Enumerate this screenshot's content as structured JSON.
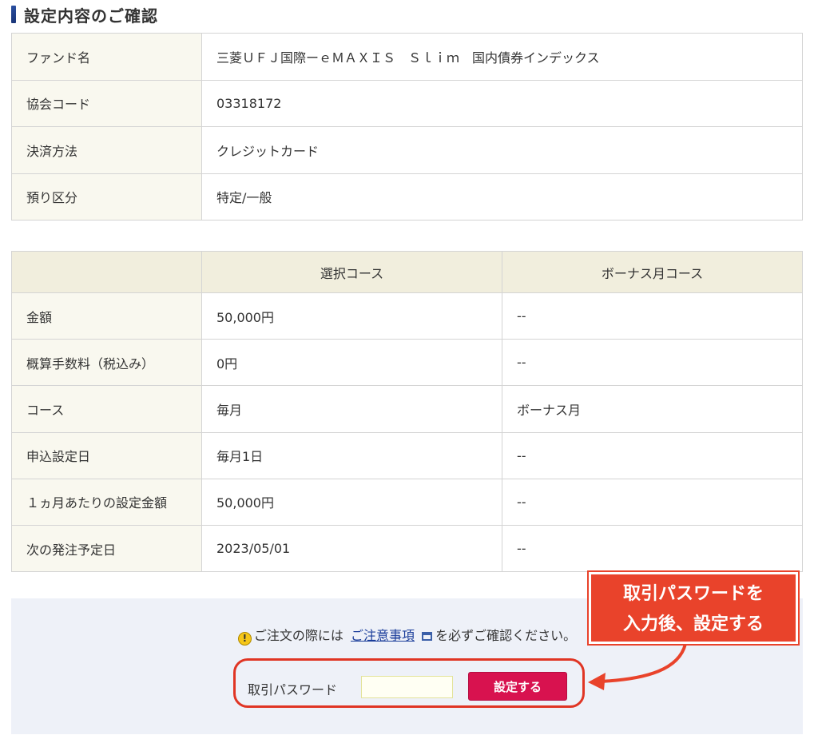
{
  "page": {
    "title": "設定内容のご確認"
  },
  "info_table": {
    "rows": [
      {
        "label": "ファンド名",
        "value": "三菱ＵＦＪ国際ーｅＭＡＸＩＳ　Ｓｌｉｍ　国内債券インデックス"
      },
      {
        "label": "協会コード",
        "value": "03318172"
      },
      {
        "label": "決済方法",
        "value": "クレジットカード"
      },
      {
        "label": "預り区分",
        "value": "特定/一般"
      }
    ]
  },
  "course_table": {
    "headers": [
      "",
      "選択コース",
      "ボーナス月コース"
    ],
    "rows": [
      {
        "label": "金額",
        "selected": "50,000円",
        "bonus": "--"
      },
      {
        "label": "概算手数料（税込み）",
        "selected": "0円",
        "bonus": "--"
      },
      {
        "label": "コース",
        "selected": "毎月",
        "bonus": "ボーナス月"
      },
      {
        "label": "申込設定日",
        "selected": "毎月1日",
        "bonus": "--"
      },
      {
        "label": "１ヵ月あたりの設定金額",
        "selected": "50,000円",
        "bonus": "--"
      },
      {
        "label": "次の発注予定日",
        "selected": "2023/05/01",
        "bonus": "--"
      }
    ]
  },
  "notice": {
    "prefix": "ご注文の際には",
    "link": "ご注意事項",
    "suffix": "を必ずご確認ください。"
  },
  "form": {
    "password_label": "取引パスワード",
    "password_value": "",
    "submit_label": "設定する"
  },
  "callout": {
    "line1": "取引パスワードを",
    "line2": "入力後、設定する"
  },
  "colors": {
    "accent_button": "#d8124f",
    "annotation_red": "#e9432b",
    "title_bar": "#1a3578"
  }
}
